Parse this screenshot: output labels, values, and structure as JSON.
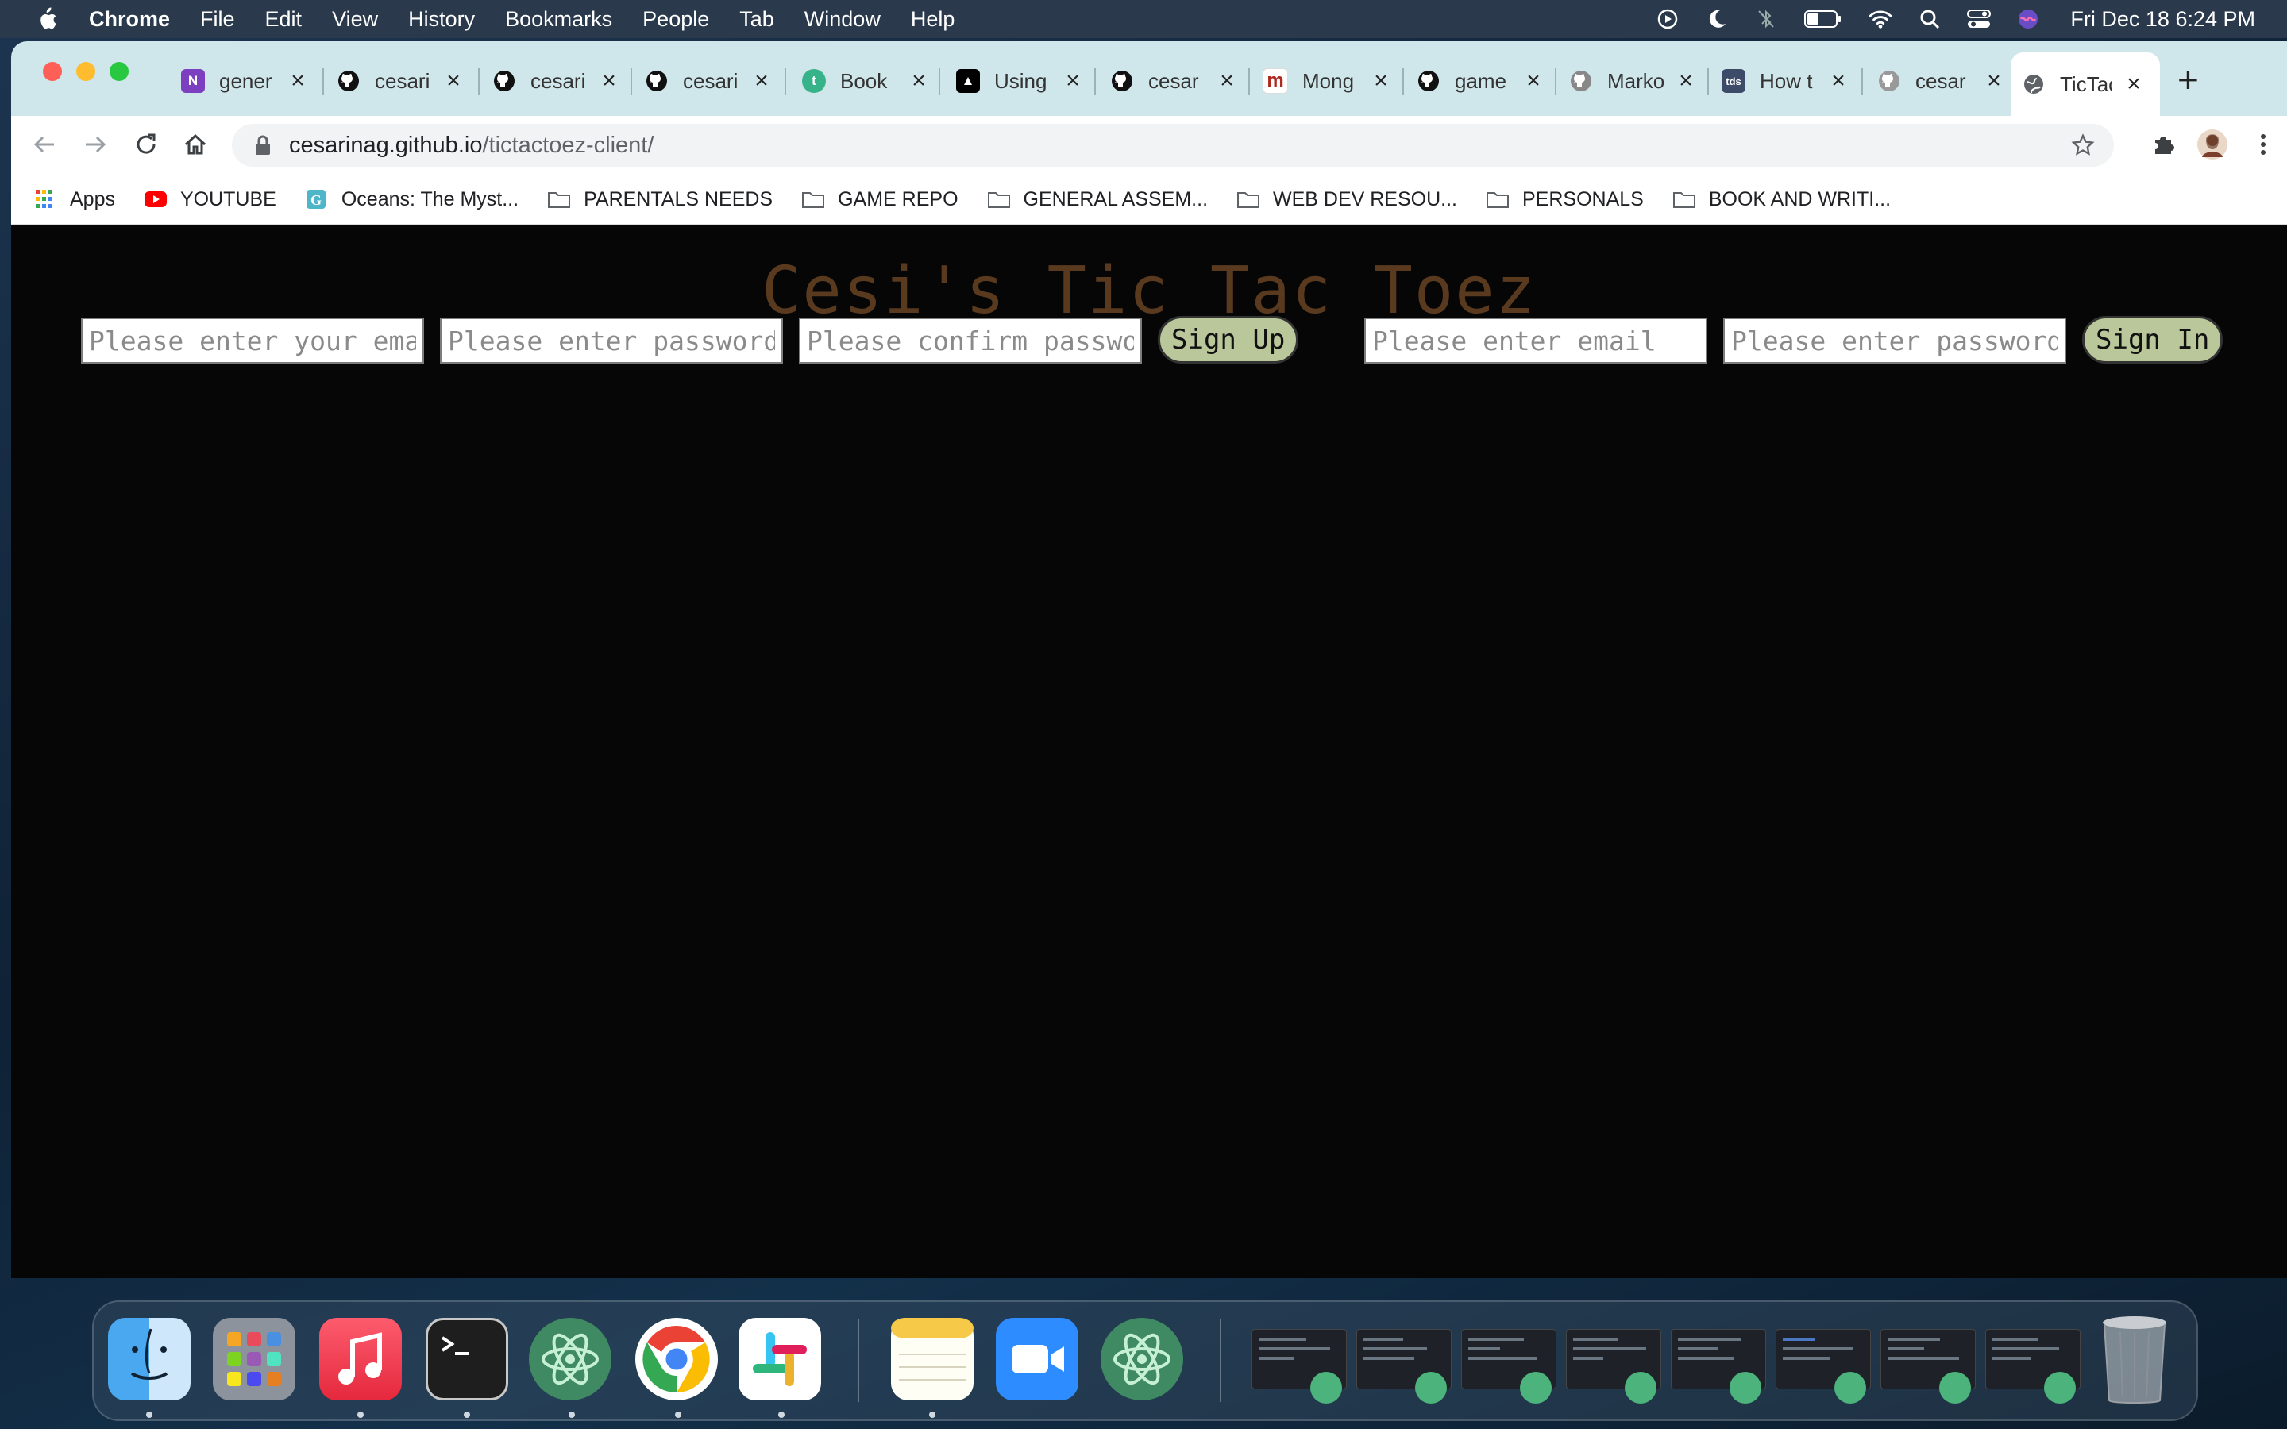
{
  "menubar": {
    "app_name": "Chrome",
    "menus": [
      "File",
      "Edit",
      "View",
      "History",
      "Bookmarks",
      "People",
      "Tab",
      "Window",
      "Help"
    ],
    "clock": "Fri Dec 18  6:24 PM"
  },
  "tabs": [
    {
      "title": "gener",
      "icon": "onenote-icon",
      "color": "#7b3fbf"
    },
    {
      "title": "cesari",
      "icon": "github-icon",
      "color": "#000000"
    },
    {
      "title": "cesari",
      "icon": "github-icon",
      "color": "#000000"
    },
    {
      "title": "cesari",
      "icon": "github-icon",
      "color": "#000000"
    },
    {
      "title": "Book",
      "icon": "tealdoc-icon",
      "color": "#37b38a"
    },
    {
      "title": "Using",
      "icon": "hat-icon",
      "color": "#000000"
    },
    {
      "title": "cesar",
      "icon": "github-icon",
      "color": "#000000"
    },
    {
      "title": "Mong",
      "icon": "m-icon",
      "color": "#b0291f"
    },
    {
      "title": "game",
      "icon": "github-icon",
      "color": "#000000"
    },
    {
      "title": "Marko",
      "icon": "github-icon",
      "color": "#888888"
    },
    {
      "title": "How t",
      "icon": "tds-icon",
      "color": "#3b4b68"
    },
    {
      "title": "cesar",
      "icon": "github-icon",
      "color": "#888888"
    },
    {
      "title": "TicTac",
      "icon": "globe-icon",
      "color": "#5f6368",
      "active": true
    }
  ],
  "omnibox": {
    "host": "cesarinag.github.io",
    "path": "/tictactoez-client/"
  },
  "bookmarks": [
    {
      "label": "Apps",
      "icon": "apps-grid-icon"
    },
    {
      "label": "YOUTUBE",
      "icon": "youtube-icon"
    },
    {
      "label": "Oceans: The Myst...",
      "icon": "g-icon"
    },
    {
      "label": "PARENTALS NEEDS",
      "icon": "folder-icon"
    },
    {
      "label": "GAME REPO",
      "icon": "folder-icon"
    },
    {
      "label": "GENERAL ASSEM...",
      "icon": "folder-icon"
    },
    {
      "label": "WEB DEV RESOU...",
      "icon": "folder-icon"
    },
    {
      "label": "PERSONALS",
      "icon": "folder-icon"
    },
    {
      "label": "BOOK AND WRITI...",
      "icon": "folder-icon"
    }
  ],
  "page": {
    "title": "Cesi's Tic Tac Toez",
    "signup": {
      "email_placeholder": "Please enter your email",
      "password_placeholder": "Please enter password",
      "confirm_placeholder": "Please confirm password",
      "button_label": "Sign Up"
    },
    "signin": {
      "email_placeholder": "Please enter email",
      "password_placeholder": "Please enter password",
      "button_label": "Sign In"
    },
    "colors": {
      "title": "#5a3a1f",
      "button_bg": "#b9c79a",
      "background": "#060606"
    }
  },
  "dock": {
    "apps": [
      "finder-icon",
      "launchpad-icon",
      "music-icon",
      "terminal-icon",
      "atom-icon",
      "chrome-icon",
      "slack-icon",
      "notes-icon",
      "zoom-icon",
      "atom-icon"
    ],
    "minimized_windows": 8,
    "trash": "trash-icon"
  }
}
